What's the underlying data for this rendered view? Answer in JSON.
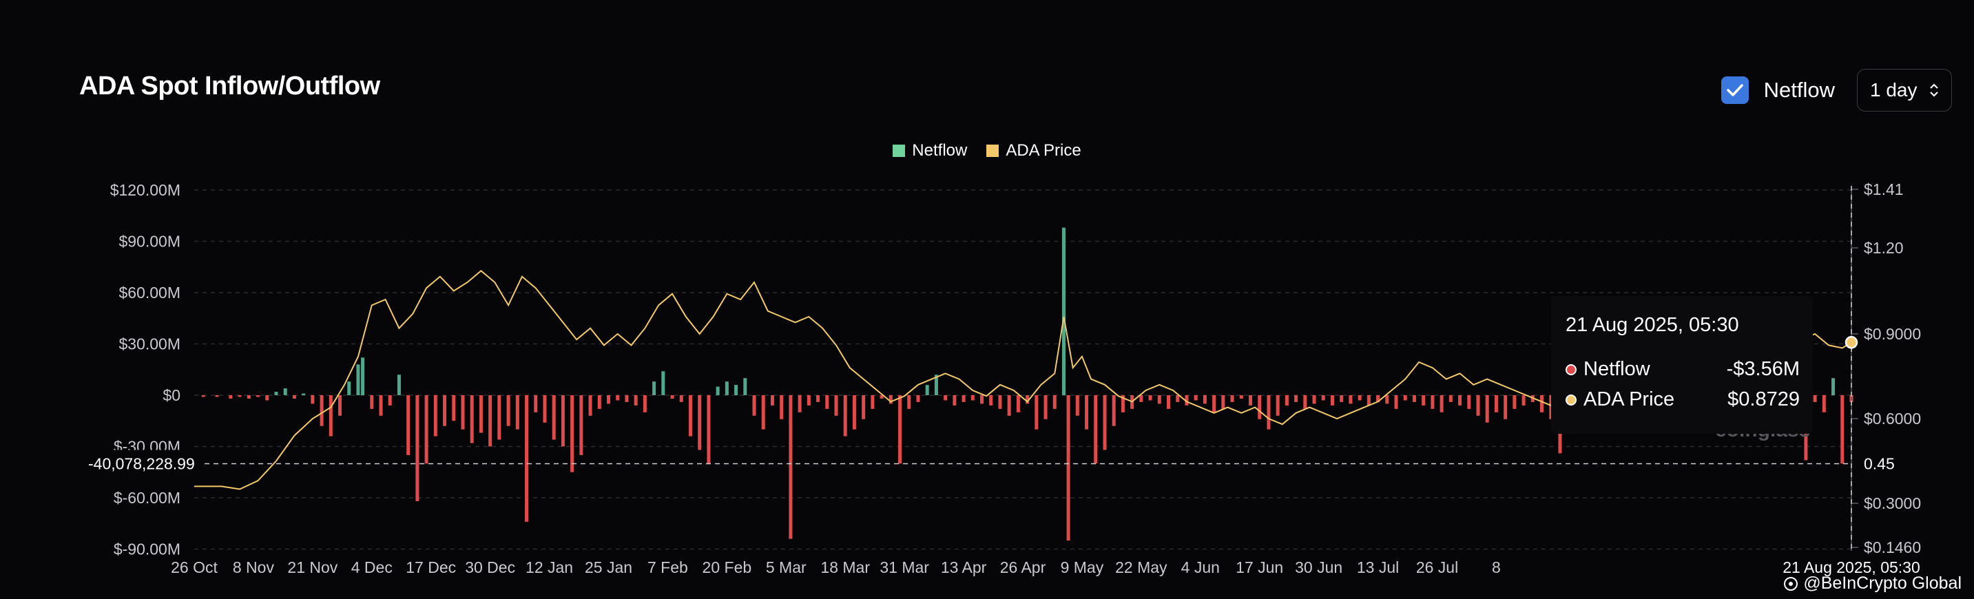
{
  "header": {
    "title": "ADA Spot Inflow/Outflow",
    "toggle_label": "Netflow",
    "interval": "1 day"
  },
  "colors": {
    "netflow_positive": "#4fa88c",
    "netflow_negative": "#e04a4a",
    "price_line": "#f3c86a",
    "checkbox": "#3a78e0"
  },
  "tooltip": {
    "date": "21 Aug 2025, 05:30",
    "netflow_label": "Netflow",
    "netflow_value": "-$3.56M",
    "price_label": "ADA Price",
    "price_value": "$0.8729"
  },
  "crosshair": {
    "y_left_label": "-40,078,228.99",
    "y_right_label": "0.45",
    "x_label": "21 Aug 2025, 05:30"
  },
  "watermark": "coinglass",
  "branding": "@BeInCrypto Global",
  "chart_data": {
    "type": "bar",
    "title": "ADA Spot Inflow/Outflow",
    "legend": [
      "Netflow",
      "ADA Price"
    ],
    "legend_position": "top-center",
    "grid": true,
    "x_ticks": [
      "26 Oct",
      "8 Nov",
      "21 Nov",
      "4 Dec",
      "17 Dec",
      "30 Dec",
      "12 Jan",
      "25 Jan",
      "7 Feb",
      "20 Feb",
      "5 Mar",
      "18 Mar",
      "31 Mar",
      "13 Apr",
      "26 Apr",
      "9 May",
      "22 May",
      "4 Jun",
      "17 Jun",
      "30 Jun",
      "13 Jul",
      "26 Jul",
      "8"
    ],
    "y_left_ticks": [
      "$120.00M",
      "$90.00M",
      "$60.00M",
      "$30.00M",
      "$0",
      "$-30.00M",
      "$-60.00M",
      "$-90.00M"
    ],
    "y_left_range": [
      -90,
      120
    ],
    "y_right_ticks": [
      "$1.41",
      "$1.20",
      "$0.9000",
      "$0.6000",
      "$0.3000",
      "$0.1460"
    ],
    "series": [
      {
        "name": "Netflow",
        "unit": "$M",
        "points": [
          [
            2,
            -1
          ],
          [
            5,
            -1
          ],
          [
            8,
            -2
          ],
          [
            10,
            -1
          ],
          [
            12,
            -2
          ],
          [
            14,
            -1
          ],
          [
            16,
            -3
          ],
          [
            18,
            2
          ],
          [
            20,
            4
          ],
          [
            22,
            -2
          ],
          [
            24,
            1
          ],
          [
            26,
            -5
          ],
          [
            28,
            -18
          ],
          [
            30,
            -24
          ],
          [
            32,
            -12
          ],
          [
            34,
            8
          ],
          [
            36,
            18
          ],
          [
            37,
            22
          ],
          [
            39,
            -8
          ],
          [
            41,
            -12
          ],
          [
            43,
            -6
          ],
          [
            45,
            12
          ],
          [
            47,
            -35
          ],
          [
            49,
            -62
          ],
          [
            51,
            -40
          ],
          [
            53,
            -24
          ],
          [
            55,
            -18
          ],
          [
            57,
            -15
          ],
          [
            59,
            -20
          ],
          [
            61,
            -28
          ],
          [
            63,
            -22
          ],
          [
            65,
            -30
          ],
          [
            67,
            -26
          ],
          [
            69,
            -18
          ],
          [
            71,
            -20
          ],
          [
            73,
            -74
          ],
          [
            75,
            -10
          ],
          [
            77,
            -16
          ],
          [
            79,
            -26
          ],
          [
            81,
            -30
          ],
          [
            83,
            -45
          ],
          [
            85,
            -35
          ],
          [
            87,
            -12
          ],
          [
            89,
            -8
          ],
          [
            91,
            -5
          ],
          [
            93,
            -3
          ],
          [
            95,
            -4
          ],
          [
            97,
            -6
          ],
          [
            99,
            -10
          ],
          [
            101,
            8
          ],
          [
            103,
            14
          ],
          [
            105,
            -2
          ],
          [
            107,
            -4
          ],
          [
            109,
            -24
          ],
          [
            111,
            -32
          ],
          [
            113,
            -40
          ],
          [
            115,
            5
          ],
          [
            117,
            8
          ],
          [
            119,
            6
          ],
          [
            121,
            10
          ],
          [
            123,
            -12
          ],
          [
            125,
            -20
          ],
          [
            127,
            -6
          ],
          [
            129,
            -14
          ],
          [
            131,
            -84
          ],
          [
            133,
            -10
          ],
          [
            135,
            -6
          ],
          [
            137,
            -4
          ],
          [
            139,
            -8
          ],
          [
            141,
            -12
          ],
          [
            143,
            -24
          ],
          [
            145,
            -20
          ],
          [
            147,
            -14
          ],
          [
            149,
            -8
          ],
          [
            151,
            -2
          ],
          [
            153,
            -5
          ],
          [
            155,
            -40
          ],
          [
            157,
            -8
          ],
          [
            159,
            -4
          ],
          [
            161,
            6
          ],
          [
            163,
            12
          ],
          [
            165,
            -3
          ],
          [
            167,
            -6
          ],
          [
            169,
            -4
          ],
          [
            171,
            -3
          ],
          [
            173,
            -5
          ],
          [
            175,
            -6
          ],
          [
            177,
            -8
          ],
          [
            179,
            -12
          ],
          [
            181,
            -10
          ],
          [
            183,
            -5
          ],
          [
            185,
            -20
          ],
          [
            187,
            -14
          ],
          [
            189,
            -8
          ],
          [
            191,
            98
          ],
          [
            192,
            -85
          ],
          [
            194,
            -12
          ],
          [
            196,
            -20
          ],
          [
            198,
            -40
          ],
          [
            200,
            -32
          ],
          [
            202,
            -18
          ],
          [
            204,
            -10
          ],
          [
            206,
            -8
          ],
          [
            208,
            -4
          ],
          [
            210,
            -3
          ],
          [
            212,
            -5
          ],
          [
            214,
            -8
          ],
          [
            216,
            -4
          ],
          [
            218,
            -6
          ],
          [
            220,
            -3
          ],
          [
            222,
            -5
          ],
          [
            224,
            -10
          ],
          [
            226,
            -8
          ],
          [
            228,
            -4
          ],
          [
            230,
            -2
          ],
          [
            232,
            -6
          ],
          [
            234,
            -14
          ],
          [
            236,
            -20
          ],
          [
            238,
            -12
          ],
          [
            240,
            -6
          ],
          [
            242,
            -4
          ],
          [
            244,
            -8
          ],
          [
            246,
            -5
          ],
          [
            248,
            -3
          ],
          [
            250,
            -6
          ],
          [
            252,
            -4
          ],
          [
            254,
            -5
          ],
          [
            256,
            -3
          ],
          [
            258,
            -6
          ],
          [
            260,
            -4
          ],
          [
            262,
            -5
          ],
          [
            264,
            -8
          ],
          [
            266,
            -3
          ],
          [
            268,
            -4
          ],
          [
            270,
            -6
          ],
          [
            272,
            -8
          ],
          [
            274,
            -10
          ],
          [
            276,
            -4
          ],
          [
            278,
            -6
          ],
          [
            280,
            -8
          ],
          [
            282,
            -12
          ],
          [
            284,
            -16
          ],
          [
            286,
            -10
          ],
          [
            288,
            -14
          ],
          [
            290,
            -8
          ],
          [
            292,
            -6
          ],
          [
            294,
            -4
          ],
          [
            296,
            -10
          ],
          [
            298,
            -14
          ],
          [
            300,
            -34
          ],
          [
            302,
            -6
          ],
          [
            304,
            -4
          ],
          [
            306,
            -8
          ],
          [
            308,
            -10
          ],
          [
            310,
            -12
          ],
          [
            312,
            -6
          ],
          [
            314,
            -4
          ],
          [
            316,
            -8
          ],
          [
            318,
            -10
          ],
          [
            320,
            -6
          ],
          [
            322,
            -4
          ],
          [
            324,
            -5
          ],
          [
            326,
            -8
          ],
          [
            328,
            -10
          ],
          [
            330,
            -12
          ],
          [
            332,
            -16
          ],
          [
            334,
            -18
          ],
          [
            336,
            -12
          ],
          [
            338,
            -10
          ],
          [
            340,
            -14
          ],
          [
            342,
            -8
          ],
          [
            344,
            -6
          ],
          [
            346,
            -4
          ],
          [
            348,
            -12
          ],
          [
            350,
            -8
          ],
          [
            352,
            -6
          ],
          [
            354,
            -38
          ],
          [
            356,
            -4
          ],
          [
            358,
            -10
          ],
          [
            360,
            10
          ],
          [
            362,
            -40
          ],
          [
            364,
            -4
          ]
        ]
      },
      {
        "name": "ADA Price",
        "unit": "$",
        "points": [
          [
            0,
            0.36
          ],
          [
            6,
            0.36
          ],
          [
            10,
            0.35
          ],
          [
            14,
            0.38
          ],
          [
            18,
            0.45
          ],
          [
            22,
            0.54
          ],
          [
            26,
            0.6
          ],
          [
            30,
            0.64
          ],
          [
            33,
            0.72
          ],
          [
            36,
            0.82
          ],
          [
            39,
            1.0
          ],
          [
            42,
            1.02
          ],
          [
            45,
            0.92
          ],
          [
            48,
            0.97
          ],
          [
            51,
            1.06
          ],
          [
            54,
            1.1
          ],
          [
            57,
            1.05
          ],
          [
            60,
            1.08
          ],
          [
            63,
            1.12
          ],
          [
            66,
            1.08
          ],
          [
            69,
            1.0
          ],
          [
            72,
            1.1
          ],
          [
            75,
            1.06
          ],
          [
            78,
            1.0
          ],
          [
            81,
            0.94
          ],
          [
            84,
            0.88
          ],
          [
            87,
            0.92
          ],
          [
            90,
            0.86
          ],
          [
            93,
            0.9
          ],
          [
            96,
            0.86
          ],
          [
            99,
            0.92
          ],
          [
            102,
            1.0
          ],
          [
            105,
            1.04
          ],
          [
            108,
            0.96
          ],
          [
            111,
            0.9
          ],
          [
            114,
            0.96
          ],
          [
            117,
            1.04
          ],
          [
            120,
            1.02
          ],
          [
            123,
            1.08
          ],
          [
            126,
            0.98
          ],
          [
            129,
            0.96
          ],
          [
            132,
            0.94
          ],
          [
            135,
            0.96
          ],
          [
            138,
            0.92
          ],
          [
            141,
            0.86
          ],
          [
            144,
            0.78
          ],
          [
            147,
            0.74
          ],
          [
            150,
            0.7
          ],
          [
            153,
            0.66
          ],
          [
            156,
            0.68
          ],
          [
            159,
            0.72
          ],
          [
            162,
            0.74
          ],
          [
            165,
            0.76
          ],
          [
            168,
            0.74
          ],
          [
            171,
            0.7
          ],
          [
            174,
            0.68
          ],
          [
            177,
            0.72
          ],
          [
            180,
            0.7
          ],
          [
            183,
            0.66
          ],
          [
            186,
            0.72
          ],
          [
            189,
            0.76
          ],
          [
            191,
            0.96
          ],
          [
            193,
            0.78
          ],
          [
            195,
            0.82
          ],
          [
            197,
            0.74
          ],
          [
            200,
            0.72
          ],
          [
            203,
            0.68
          ],
          [
            206,
            0.66
          ],
          [
            209,
            0.7
          ],
          [
            212,
            0.72
          ],
          [
            215,
            0.7
          ],
          [
            218,
            0.66
          ],
          [
            221,
            0.64
          ],
          [
            224,
            0.62
          ],
          [
            227,
            0.64
          ],
          [
            230,
            0.62
          ],
          [
            233,
            0.64
          ],
          [
            236,
            0.6
          ],
          [
            239,
            0.58
          ],
          [
            242,
            0.62
          ],
          [
            245,
            0.64
          ],
          [
            248,
            0.62
          ],
          [
            251,
            0.6
          ],
          [
            254,
            0.62
          ],
          [
            257,
            0.64
          ],
          [
            260,
            0.66
          ],
          [
            263,
            0.7
          ],
          [
            266,
            0.74
          ],
          [
            269,
            0.8
          ],
          [
            272,
            0.78
          ],
          [
            275,
            0.74
          ],
          [
            278,
            0.76
          ],
          [
            281,
            0.72
          ],
          [
            284,
            0.74
          ],
          [
            287,
            0.72
          ],
          [
            290,
            0.7
          ],
          [
            293,
            0.68
          ],
          [
            296,
            0.66
          ],
          [
            299,
            0.64
          ],
          [
            302,
            0.66
          ],
          [
            305,
            0.68
          ],
          [
            308,
            0.66
          ],
          [
            311,
            0.64
          ],
          [
            314,
            0.62
          ],
          [
            317,
            0.64
          ],
          [
            320,
            0.62
          ],
          [
            323,
            0.6
          ],
          [
            326,
            0.58
          ],
          [
            329,
            0.56
          ],
          [
            332,
            0.55
          ],
          [
            335,
            0.56
          ],
          [
            338,
            0.55
          ],
          [
            341,
            0.72
          ],
          [
            344,
            0.76
          ],
          [
            347,
            0.82
          ],
          [
            350,
            0.86
          ],
          [
            353,
            0.88
          ],
          [
            356,
            0.9
          ],
          [
            359,
            0.86
          ],
          [
            362,
            0.85
          ],
          [
            364,
            0.87
          ]
        ]
      }
    ]
  }
}
